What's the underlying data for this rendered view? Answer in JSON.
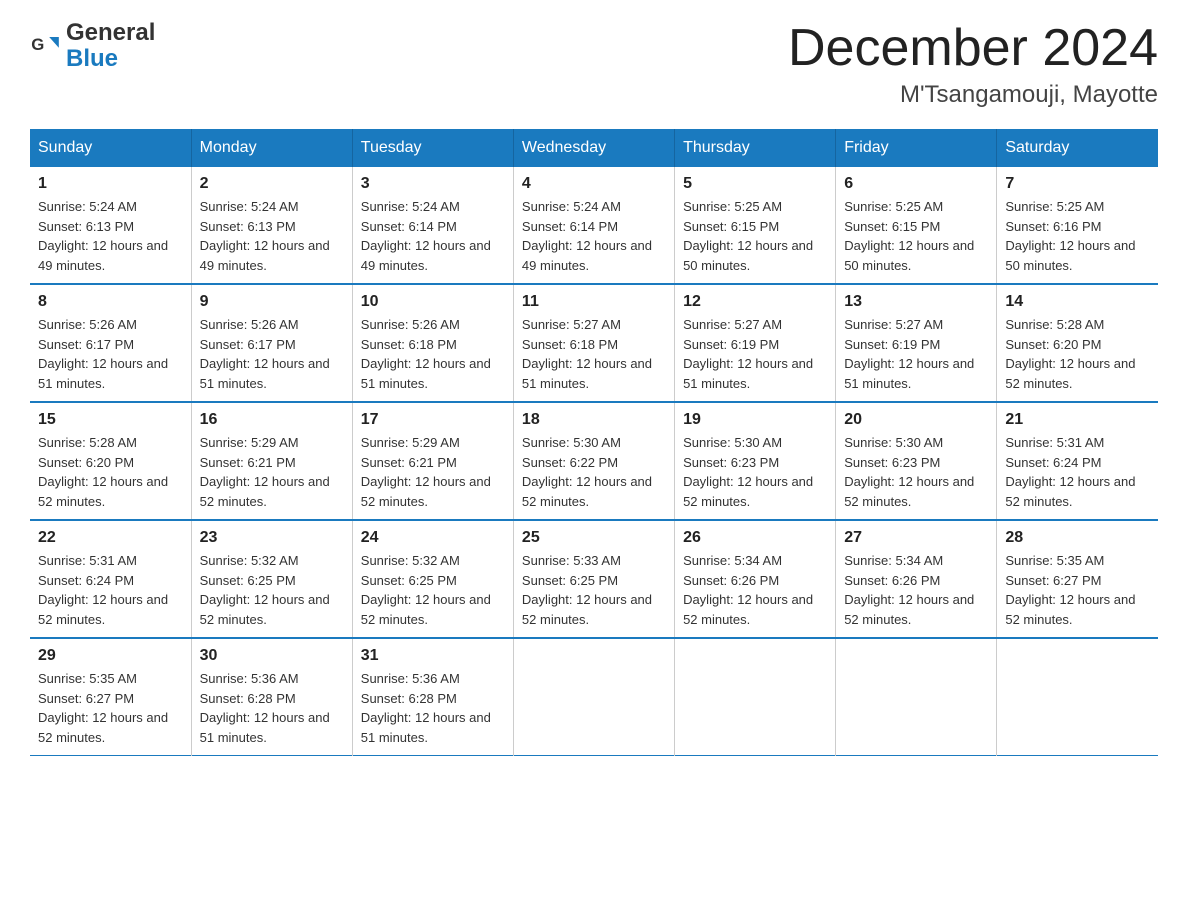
{
  "header": {
    "logo_general": "General",
    "logo_blue": "Blue",
    "month_title": "December 2024",
    "location": "M'Tsangamouji, Mayotte"
  },
  "days_of_week": [
    "Sunday",
    "Monday",
    "Tuesday",
    "Wednesday",
    "Thursday",
    "Friday",
    "Saturday"
  ],
  "weeks": [
    [
      {
        "day": "1",
        "sunrise": "5:24 AM",
        "sunset": "6:13 PM",
        "daylight": "12 hours and 49 minutes."
      },
      {
        "day": "2",
        "sunrise": "5:24 AM",
        "sunset": "6:13 PM",
        "daylight": "12 hours and 49 minutes."
      },
      {
        "day": "3",
        "sunrise": "5:24 AM",
        "sunset": "6:14 PM",
        "daylight": "12 hours and 49 minutes."
      },
      {
        "day": "4",
        "sunrise": "5:24 AM",
        "sunset": "6:14 PM",
        "daylight": "12 hours and 49 minutes."
      },
      {
        "day": "5",
        "sunrise": "5:25 AM",
        "sunset": "6:15 PM",
        "daylight": "12 hours and 50 minutes."
      },
      {
        "day": "6",
        "sunrise": "5:25 AM",
        "sunset": "6:15 PM",
        "daylight": "12 hours and 50 minutes."
      },
      {
        "day": "7",
        "sunrise": "5:25 AM",
        "sunset": "6:16 PM",
        "daylight": "12 hours and 50 minutes."
      }
    ],
    [
      {
        "day": "8",
        "sunrise": "5:26 AM",
        "sunset": "6:17 PM",
        "daylight": "12 hours and 51 minutes."
      },
      {
        "day": "9",
        "sunrise": "5:26 AM",
        "sunset": "6:17 PM",
        "daylight": "12 hours and 51 minutes."
      },
      {
        "day": "10",
        "sunrise": "5:26 AM",
        "sunset": "6:18 PM",
        "daylight": "12 hours and 51 minutes."
      },
      {
        "day": "11",
        "sunrise": "5:27 AM",
        "sunset": "6:18 PM",
        "daylight": "12 hours and 51 minutes."
      },
      {
        "day": "12",
        "sunrise": "5:27 AM",
        "sunset": "6:19 PM",
        "daylight": "12 hours and 51 minutes."
      },
      {
        "day": "13",
        "sunrise": "5:27 AM",
        "sunset": "6:19 PM",
        "daylight": "12 hours and 51 minutes."
      },
      {
        "day": "14",
        "sunrise": "5:28 AM",
        "sunset": "6:20 PM",
        "daylight": "12 hours and 52 minutes."
      }
    ],
    [
      {
        "day": "15",
        "sunrise": "5:28 AM",
        "sunset": "6:20 PM",
        "daylight": "12 hours and 52 minutes."
      },
      {
        "day": "16",
        "sunrise": "5:29 AM",
        "sunset": "6:21 PM",
        "daylight": "12 hours and 52 minutes."
      },
      {
        "day": "17",
        "sunrise": "5:29 AM",
        "sunset": "6:21 PM",
        "daylight": "12 hours and 52 minutes."
      },
      {
        "day": "18",
        "sunrise": "5:30 AM",
        "sunset": "6:22 PM",
        "daylight": "12 hours and 52 minutes."
      },
      {
        "day": "19",
        "sunrise": "5:30 AM",
        "sunset": "6:23 PM",
        "daylight": "12 hours and 52 minutes."
      },
      {
        "day": "20",
        "sunrise": "5:30 AM",
        "sunset": "6:23 PM",
        "daylight": "12 hours and 52 minutes."
      },
      {
        "day": "21",
        "sunrise": "5:31 AM",
        "sunset": "6:24 PM",
        "daylight": "12 hours and 52 minutes."
      }
    ],
    [
      {
        "day": "22",
        "sunrise": "5:31 AM",
        "sunset": "6:24 PM",
        "daylight": "12 hours and 52 minutes."
      },
      {
        "day": "23",
        "sunrise": "5:32 AM",
        "sunset": "6:25 PM",
        "daylight": "12 hours and 52 minutes."
      },
      {
        "day": "24",
        "sunrise": "5:32 AM",
        "sunset": "6:25 PM",
        "daylight": "12 hours and 52 minutes."
      },
      {
        "day": "25",
        "sunrise": "5:33 AM",
        "sunset": "6:25 PM",
        "daylight": "12 hours and 52 minutes."
      },
      {
        "day": "26",
        "sunrise": "5:34 AM",
        "sunset": "6:26 PM",
        "daylight": "12 hours and 52 minutes."
      },
      {
        "day": "27",
        "sunrise": "5:34 AM",
        "sunset": "6:26 PM",
        "daylight": "12 hours and 52 minutes."
      },
      {
        "day": "28",
        "sunrise": "5:35 AM",
        "sunset": "6:27 PM",
        "daylight": "12 hours and 52 minutes."
      }
    ],
    [
      {
        "day": "29",
        "sunrise": "5:35 AM",
        "sunset": "6:27 PM",
        "daylight": "12 hours and 52 minutes."
      },
      {
        "day": "30",
        "sunrise": "5:36 AM",
        "sunset": "6:28 PM",
        "daylight": "12 hours and 51 minutes."
      },
      {
        "day": "31",
        "sunrise": "5:36 AM",
        "sunset": "6:28 PM",
        "daylight": "12 hours and 51 minutes."
      },
      null,
      null,
      null,
      null
    ]
  ]
}
